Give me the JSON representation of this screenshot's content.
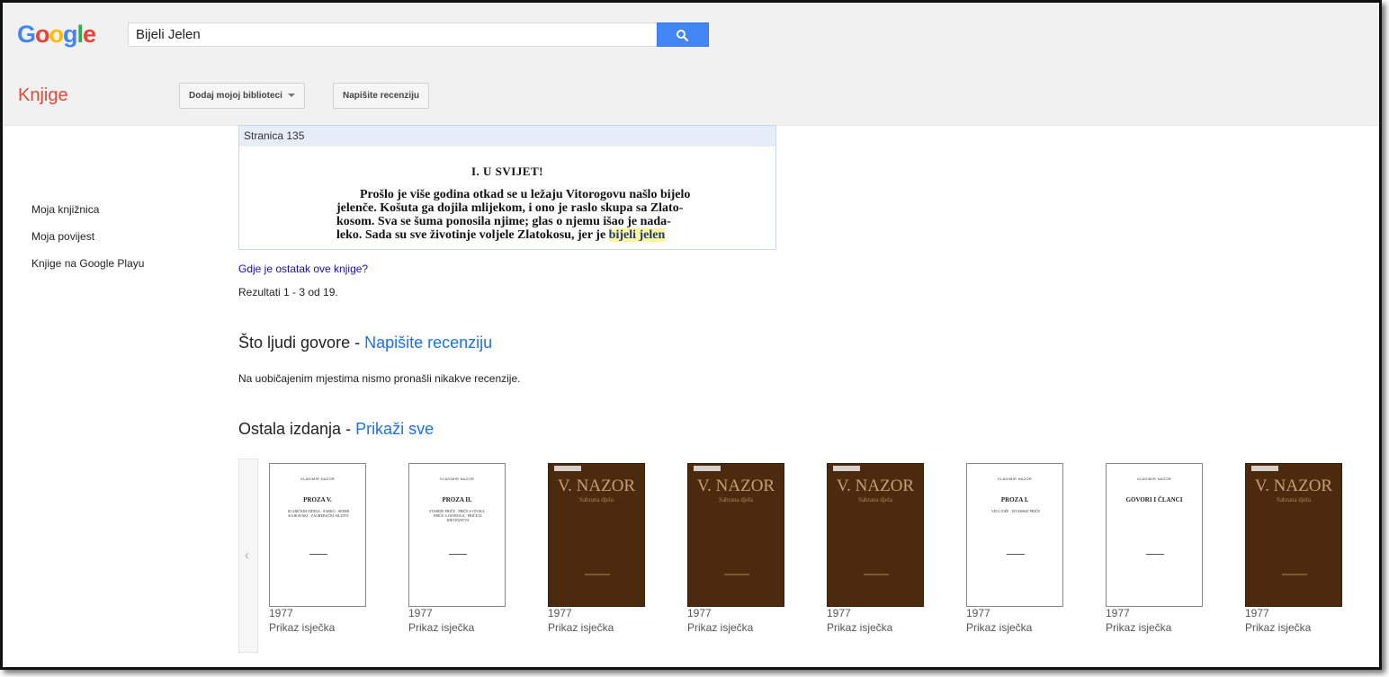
{
  "header": {
    "logo_letters": [
      "G",
      "o",
      "o",
      "g",
      "l",
      "e"
    ],
    "logo_colors": [
      "#4285f4",
      "#ea4335",
      "#fbbc05",
      "#4285f4",
      "#34a853",
      "#ea4335"
    ],
    "search_value": "Bijeli Jelen",
    "search_icon": "search-icon"
  },
  "appbar": {
    "title": "Knjige",
    "add_library_label": "Dodaj mojoj biblioteci",
    "write_review_label": "Napišite recenziju"
  },
  "sidebar": {
    "items": [
      {
        "label": "Moja knjižnica"
      },
      {
        "label": "Moja povijest"
      },
      {
        "label": "Knjige na Google Playu"
      }
    ]
  },
  "snippet": {
    "page_label": "Stranica 135",
    "chapter": "I. U SVIJET!",
    "lines": [
      "Prošlo je više godina otkad se u ležaju Vitorogovu našlo bijelo",
      "jelenče. Košuta ga dojila mlijekom, i ono je raslo skupa sa Zlato-",
      "kosom. Sva se šuma ponosila njime; glas o njemu išao je nada-",
      "leko. Sada su sve životinje voljele Zlatokosu, jer je "
    ],
    "highlight": "bijeli jelen"
  },
  "main": {
    "remaining_link": "Gdje je ostatak ove knjige?",
    "results_text": "Rezultati 1 - 3 od 19.",
    "reviews_heading": "Što ljudi govore - ",
    "reviews_link": "Napišite recenziju",
    "no_reviews_text": "Na uobičajenim mjestima nismo pronašli nikakve recenzije.",
    "editions_heading": "Ostala izdanja - ",
    "editions_link": "Prikaži sve"
  },
  "carousel": {
    "prev_icon": "chevron-left-icon",
    "books": [
      {
        "style": "light",
        "author": "VLADIMIR NAZOR",
        "title": "PROZA V.",
        "subtitle": "IZ GRIČKIH ZIDINA · ŠARKO · SEDMI KAJKAVSKI · ZAGREBAČKI SILUETI",
        "year": "1977",
        "label": "Prikaz isječka"
      },
      {
        "style": "light",
        "author": "VLADIMIR NAZOR",
        "title": "PROZA II.",
        "subtitle": "STARIDE PRIČE · PRIČE S OTOKA · PRIČE S OSTROGA · PRIČE IZ DJETINJSTVA",
        "year": "1977",
        "label": "Prikaz isječka"
      },
      {
        "style": "dark",
        "author": "V. NAZOR",
        "title": "Sabrana djela",
        "year": "1977",
        "label": "Prikaz isječka"
      },
      {
        "style": "dark",
        "author": "V. NAZOR",
        "title": "Sabrana djela",
        "year": "1977",
        "label": "Prikaz isječka"
      },
      {
        "style": "dark",
        "author": "V. NAZOR",
        "title": "Sabrana djela",
        "year": "1977",
        "label": "Prikaz isječka"
      },
      {
        "style": "light",
        "author": "VLADIMIR NAZOR",
        "title": "PROZA I.",
        "subtitle": "VELI JOŽE · ISTARSKE PRIČE",
        "year": "1977",
        "label": "Prikaz isječka"
      },
      {
        "style": "light",
        "author": "VLADIMIR NAZOR",
        "title": "GOVORI I ČLANCI",
        "subtitle": "",
        "year": "1977",
        "label": "Prikaz isječka"
      },
      {
        "style": "dark",
        "author": "V. NAZOR",
        "title": "Sabrana djela",
        "year": "1977",
        "label": "Prikaz isječka"
      }
    ]
  }
}
